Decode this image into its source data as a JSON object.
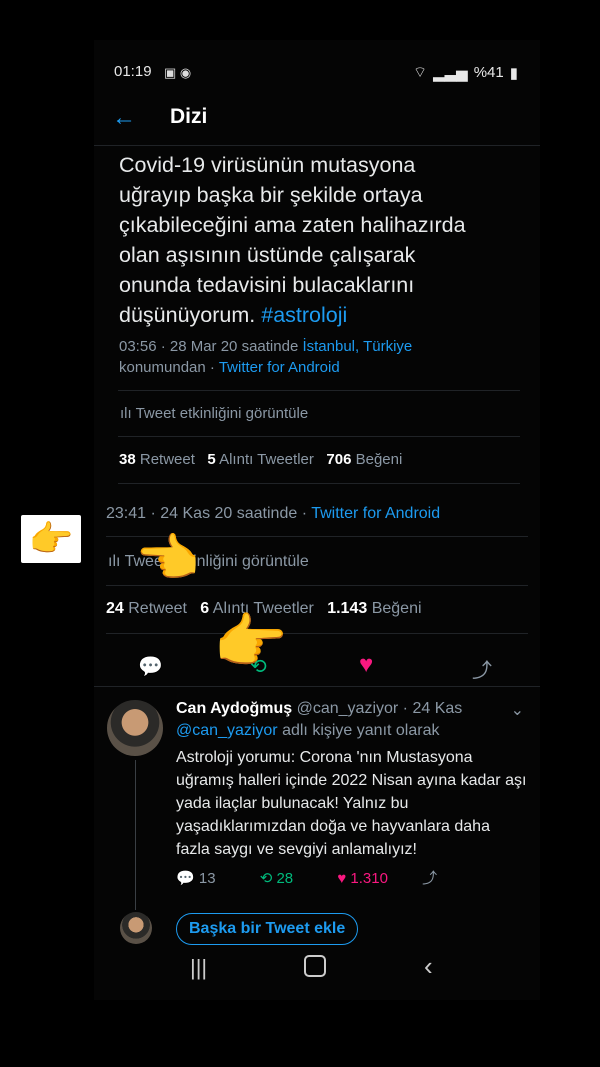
{
  "status_bar": {
    "time": "01:19",
    "battery": "%41"
  },
  "app_bar": {
    "back_icon": "arrow-left-icon",
    "title": "Dizi"
  },
  "main_tweet": {
    "text_lines": [
      "Covid-19 virüsünün mutasyona",
      "uğrayıp başka bir şekilde ortaya",
      "çıkabileceğini ama zaten halihazırda",
      "olan aşısının üstünde çalışarak",
      "onunda tedavisini bulacaklarını",
      "düşünüyorum."
    ],
    "hashtag": "#astroloji",
    "meta_time": "03:56 · 28 Mar 20 saatinde",
    "meta_location": "İstanbul, Türkiye",
    "meta_location_suffix": "konumundan ·",
    "meta_client": "Twitter for Android",
    "activity": "Tweet etkinliğini görüntüle",
    "retweets": "38",
    "retweets_label": "Retweet",
    "quotes": "5",
    "quotes_label": "Alıntı Tweetler",
    "likes": "706",
    "likes_label": "Beğeni"
  },
  "quote_tweet": {
    "meta_time": "23:41 · 24 Kas 20 saatinde ·",
    "meta_client": "Twitter for Android",
    "activity": "Tweet etkinliğini görüntüle",
    "retweets": "24",
    "retweets_label": "Retweet",
    "quotes": "6",
    "quotes_label": "Alıntı Tweetler",
    "likes": "1.143",
    "likes_label": "Beğeni"
  },
  "reply": {
    "name": "Can Aydoğmuş",
    "handle": "@can_yaziyor · 24 Kas",
    "replying_to": "@can_yaziyor",
    "replying_suffix": "adlı kişiye yanıt olarak",
    "text": "Astroloji yorumu: Corona 'nın Mustasyona uğramış halleri içinde 2022 Nisan ayına kadar aşı yada ilaçlar bulunacak! Yalnız bu yaşadıklarımızdan doğa ve hayvanlara daha fazla saygı ve sevgiyi anlamalıyız!",
    "replies": "13",
    "retweets": "28",
    "likes": "1.310"
  },
  "compose": {
    "add_button": "Başka bir Tweet ekle"
  },
  "colors": {
    "accent": "#1d9bf0",
    "like": "#f91880",
    "retweet": "#00ba7c"
  }
}
